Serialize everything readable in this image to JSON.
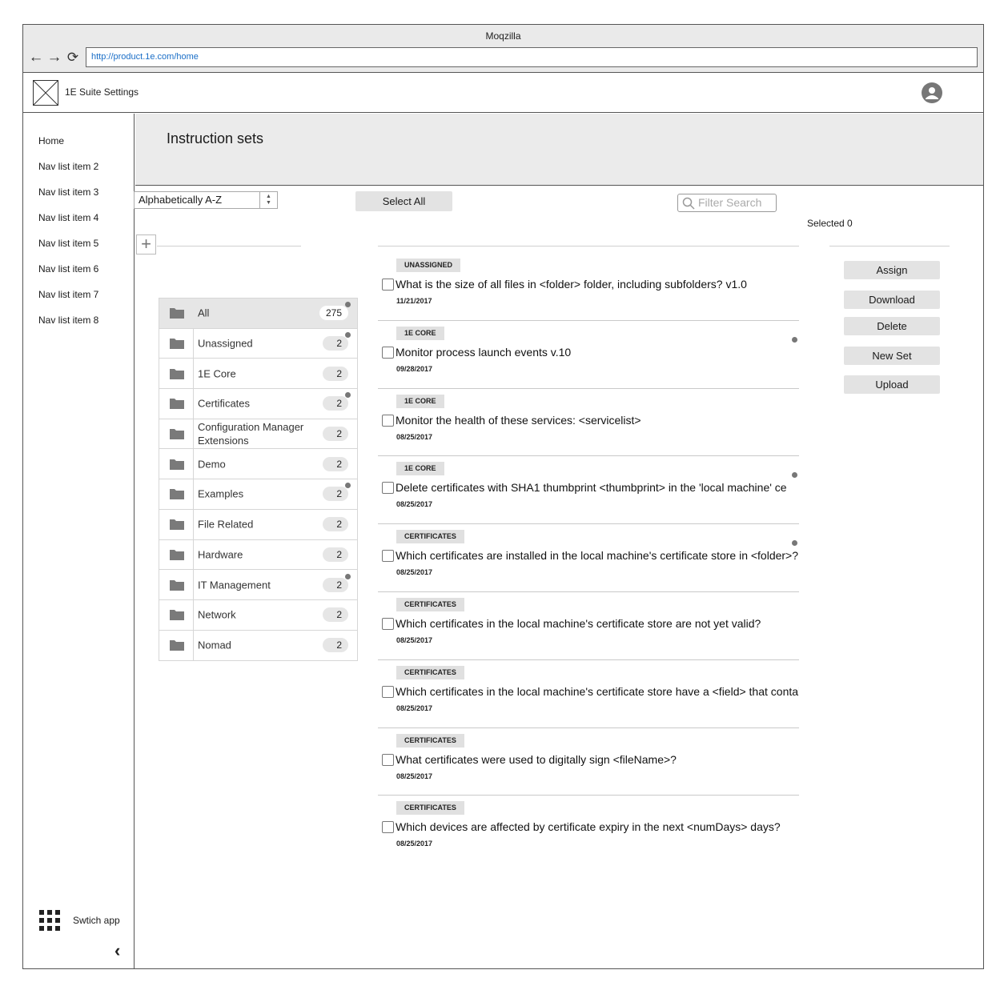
{
  "browser": {
    "title": "Moqzilla",
    "url": "http://product.1e.com/home"
  },
  "app": {
    "title": "1E Suite Settings"
  },
  "sidebar": {
    "items": [
      "Home",
      "Nav list item 2",
      "Nav list item 3",
      "Nav list item 4",
      "Nav list item 5",
      "Nav list item 6",
      "Nav list item 7",
      "Nav list item 8"
    ],
    "switch_app_label": "Swtich app"
  },
  "page": {
    "title": "Instruction sets"
  },
  "sort": {
    "selected": "Alphabetically A-Z"
  },
  "folders": [
    {
      "label": "All",
      "count": "275",
      "dot": true,
      "active": true
    },
    {
      "label": "Unassigned",
      "count": "2",
      "dot": true
    },
    {
      "label": "1E Core",
      "count": "2",
      "dot": false
    },
    {
      "label": "Certificates",
      "count": "2",
      "dot": true
    },
    {
      "label": "Configuration Manager Extensions",
      "count": "2",
      "dot": false
    },
    {
      "label": "Demo",
      "count": "2",
      "dot": false
    },
    {
      "label": "Examples",
      "count": "2",
      "dot": true
    },
    {
      "label": "File Related",
      "count": "2",
      "dot": false
    },
    {
      "label": "Hardware",
      "count": "2",
      "dot": false
    },
    {
      "label": "IT Management",
      "count": "2",
      "dot": true
    },
    {
      "label": "Network",
      "count": "2",
      "dot": false
    },
    {
      "label": "Nomad",
      "count": "2",
      "dot": false
    }
  ],
  "toolbar": {
    "select_all_label": "Select All",
    "filter_placeholder": "Filter Search"
  },
  "instructions": [
    {
      "badge": "UNASSIGNED",
      "title": "What is the size of all files in <folder> folder, including subfolders? v1.0",
      "date": "11/21/2017",
      "dot": false
    },
    {
      "badge": "1E CORE",
      "title": "Monitor process launch events v.10",
      "date": "09/28/2017",
      "dot": true
    },
    {
      "badge": "1E CORE",
      "title": "Monitor the health of these services: <servicelist>",
      "date": "08/25/2017",
      "dot": false
    },
    {
      "badge": "1E CORE",
      "title": "Delete certificates with SHA1 thumbprint <thumbprint> in the 'local machine' ce",
      "date": "08/25/2017",
      "dot": true
    },
    {
      "badge": "CERTIFICATES",
      "title": "Which certificates are installed in the local machine's certificate store in <folder>?",
      "date": "08/25/2017",
      "dot": true
    },
    {
      "badge": "CERTIFICATES",
      "title": "Which certificates in the local machine's certificate store are not yet valid?",
      "date": "08/25/2017",
      "dot": false
    },
    {
      "badge": "CERTIFICATES",
      "title": "Which certificates in the local machine's certificate store have a <field> that contai",
      "date": "08/25/2017",
      "dot": false
    },
    {
      "badge": "CERTIFICATES",
      "title": "What certificates were used to digitally sign <fileName>?",
      "date": "08/25/2017",
      "dot": false
    },
    {
      "badge": "CERTIFICATES",
      "title": "Which devices are affected by certificate expiry in the next <numDays> days?",
      "date": "08/25/2017",
      "dot": false
    }
  ],
  "selection": {
    "label": "Selected 0"
  },
  "actions": [
    "Assign",
    "Download",
    "Delete",
    "New Set",
    "Upload"
  ]
}
